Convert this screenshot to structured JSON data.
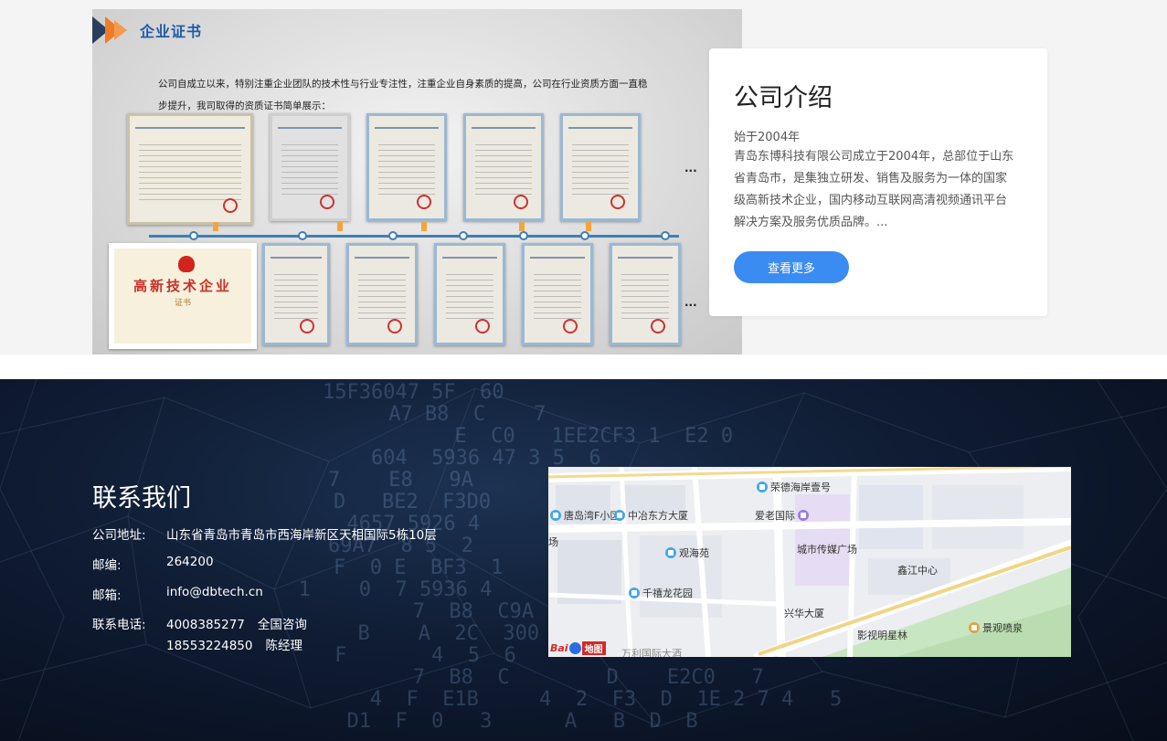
{
  "certificate_panel": {
    "heading": "企业证书",
    "intro_line1": "公司自成立以来，特别注重企业团队的技术性与行业专注性，注重企业自身素质的提高，公司在行业资质方面一直稳",
    "intro_line2": "步提升，我司取得的资质证书简单展示：",
    "honor_title": "高新技术企业",
    "honor_subtitle": "证书",
    "more_dots": "...",
    "accent_colors": {
      "arrow_dark": "#2a3d5c",
      "arrow_orange": "#f07b27",
      "heading": "#1e5aa8",
      "timeline": "#3d7fb5"
    }
  },
  "intro_card": {
    "title": "公司介绍",
    "year": "始于2004年",
    "body": "青岛东博科技有限公司成立于2004年，总部位于山东省青岛市，是集独立研发、销售及服务为一体的国家级高新技术企业，国内移动互联网高清视频通讯平台解决方案及服务优质品牌。...",
    "more_button": "查看更多",
    "button_color": "#3b8cf2"
  },
  "contact": {
    "title": "联系我们",
    "address_label": "公司地址:",
    "address": "山东省青岛市青岛市西海岸新区天相国际5栋10层",
    "postcode_label": "邮编:",
    "postcode": "264200",
    "email_label": "邮箱:",
    "email": "info@dbtech.cn",
    "phone_label": "联系电话:",
    "phone1": "4008385277",
    "phone1_note": "全国咨询",
    "phone2": "18553224850",
    "phone2_note": "陈经理"
  },
  "map": {
    "pois": [
      "荣德海岸壹号",
      "唐岛湾F小区",
      "中冶东方大厦",
      "爱老国际",
      "观海苑",
      "城市传媒广场",
      "鑫江中心",
      "千禧龙花园",
      "兴华大厦",
      "影视明星林",
      "景观喷泉",
      "万利国际大酒",
      "场"
    ],
    "logo_text": "Bai",
    "logo_text2": "地图"
  },
  "background_hex": [
    "    15F36047 5F  60",
    "         A7 B8  C    7",
    "              E  C0   1EE2CF3 1  E2 0",
    "        604  5936 47 3 5  6",
    "    7    E8   9A",
    "    D   BE2  F3D0",
    "      4657 5926 4",
    "    69A7  8 5  2",
    "    F  0 E  BF3  1",
    "  1    0  7 5936 4",
    "           7  B8  C9A",
    "      B    A  2C  300",
    "     F       4  5  6",
    "           7  B8  C        D    E2C0   7",
    "       4  F  E1B     4  2  F3  D  1E 2 7 4   5",
    "      D1  F  0   3      A   B  D  B"
  ]
}
